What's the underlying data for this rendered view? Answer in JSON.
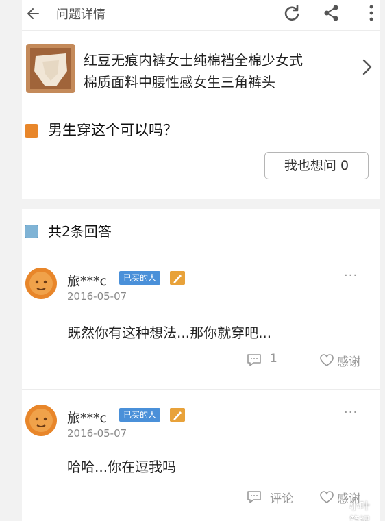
{
  "header": {
    "title": "问题详情",
    "icons": [
      "back-arrow-icon",
      "refresh-icon",
      "share-icon",
      "more-vertical-icon"
    ]
  },
  "product": {
    "title_line1": "红豆无痕内裤女士纯棉裆全棉少女式",
    "title_line2": "棉质面料中腰性感女生三角裤头"
  },
  "question": {
    "text": "男生穿这个可以吗？",
    "ask_button": "我也想问 0"
  },
  "answers_header": {
    "count_text": "共2条回答"
  },
  "answers": [
    {
      "user": "旅***c",
      "badge": "已买的人",
      "date": "2016-05-07",
      "more": "···",
      "text": "既然你有这种想法...那你就穿吧...",
      "comment": "1",
      "thanks": "感谢"
    },
    {
      "user": "旅***c",
      "badge": "已买的人",
      "date": "2016-05-07",
      "more": "···",
      "text": "哈哈...你在逗我吗",
      "comment": "评论",
      "thanks": "感谢"
    }
  ],
  "watermark": "小叶笔记",
  "colors": {
    "accent_orange": "#e8862a",
    "badge_blue": "#4a90d9"
  }
}
